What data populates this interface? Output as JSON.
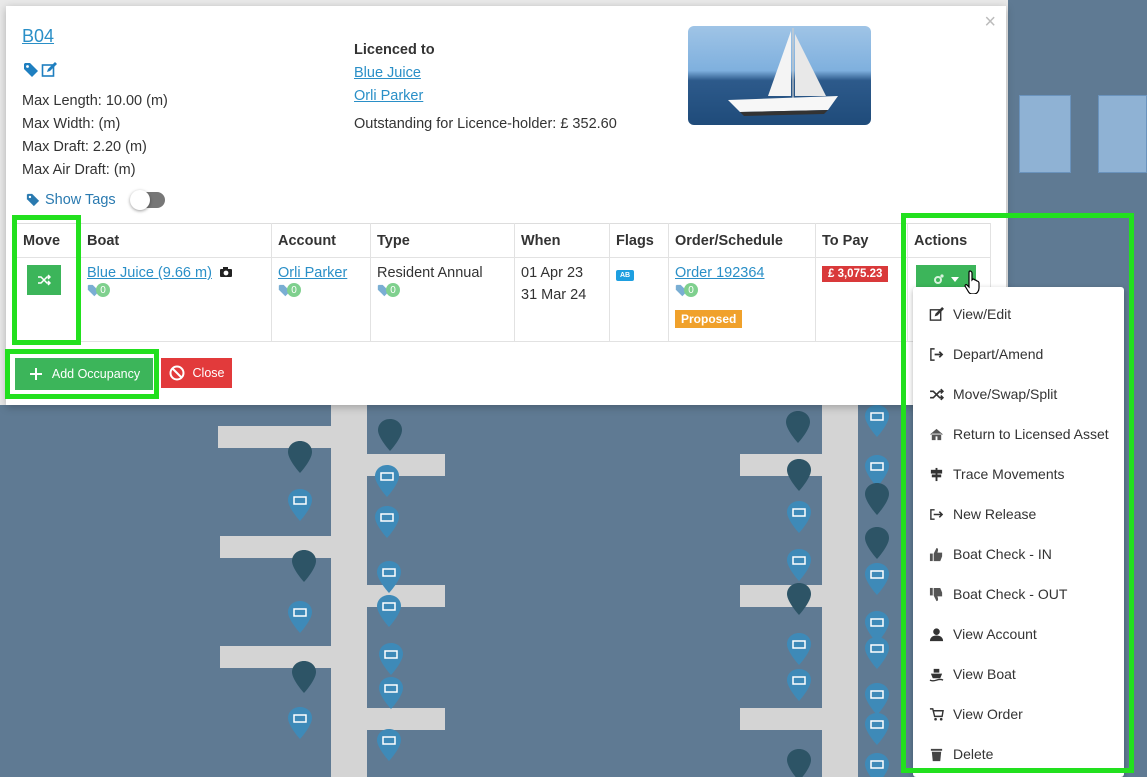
{
  "modal": {
    "berth_code": "B04",
    "dimensions": {
      "max_length": "Max Length: 10.00 (m)",
      "max_width": "Max Width: (m)",
      "max_draft": "Max Draft: 2.20 (m)",
      "max_air_draft": "Max Air Draft: (m)"
    },
    "licence": {
      "label": "Licenced to",
      "boat_link": "Blue Juice",
      "person_link": "Orli Parker",
      "outstanding": "Outstanding for Licence-holder: £ 352.60"
    },
    "show_tags_label": "Show Tags",
    "close_symbol": "×",
    "table": {
      "headers": [
        "Move",
        "Boat",
        "Account",
        "Type",
        "When",
        "Flags",
        "Order/Schedule",
        "To Pay",
        "Actions"
      ],
      "rows": [
        {
          "boat": "Blue Juice (9.66 m)",
          "boat_tag_count": "0",
          "account": "Orli Parker",
          "account_tag_count": "0",
          "type": "Resident Annual",
          "type_tag_count": "0",
          "when_start": "01 Apr 23",
          "when_end": "31 Mar 24",
          "flag": "AB",
          "order": "Order 192364",
          "order_tag_count": "0",
          "order_status": "Proposed",
          "to_pay": "£ 3,075.23"
        }
      ]
    },
    "buttons": {
      "add_occupancy": "Add Occupancy",
      "close": "Close"
    }
  },
  "actions_menu": {
    "items": [
      {
        "label": "View/Edit",
        "icon": "edit-icon"
      },
      {
        "label": "Depart/Amend",
        "icon": "sign-out-icon"
      },
      {
        "label": "Move/Swap/Split",
        "icon": "shuffle-icon"
      },
      {
        "label": "Return to Licensed Asset",
        "icon": "home-icon"
      },
      {
        "label": "Trace Movements",
        "icon": "signpost-icon"
      },
      {
        "label": "New Release",
        "icon": "share-icon"
      },
      {
        "label": "Boat Check - IN",
        "icon": "thumbs-up-icon"
      },
      {
        "label": "Boat Check - OUT",
        "icon": "thumbs-down-icon"
      },
      {
        "label": "View Account",
        "icon": "user-icon"
      },
      {
        "label": "View Boat",
        "icon": "ship-icon"
      },
      {
        "label": "View Order",
        "icon": "cart-icon"
      },
      {
        "label": "Delete",
        "icon": "trash-icon"
      }
    ]
  },
  "colors": {
    "link": "#2a8fc7",
    "success": "#3cb55a",
    "danger": "#e23a3b",
    "warning": "#f0a12b",
    "highlight": "#22e01e",
    "map_water": "#5f7a93"
  }
}
